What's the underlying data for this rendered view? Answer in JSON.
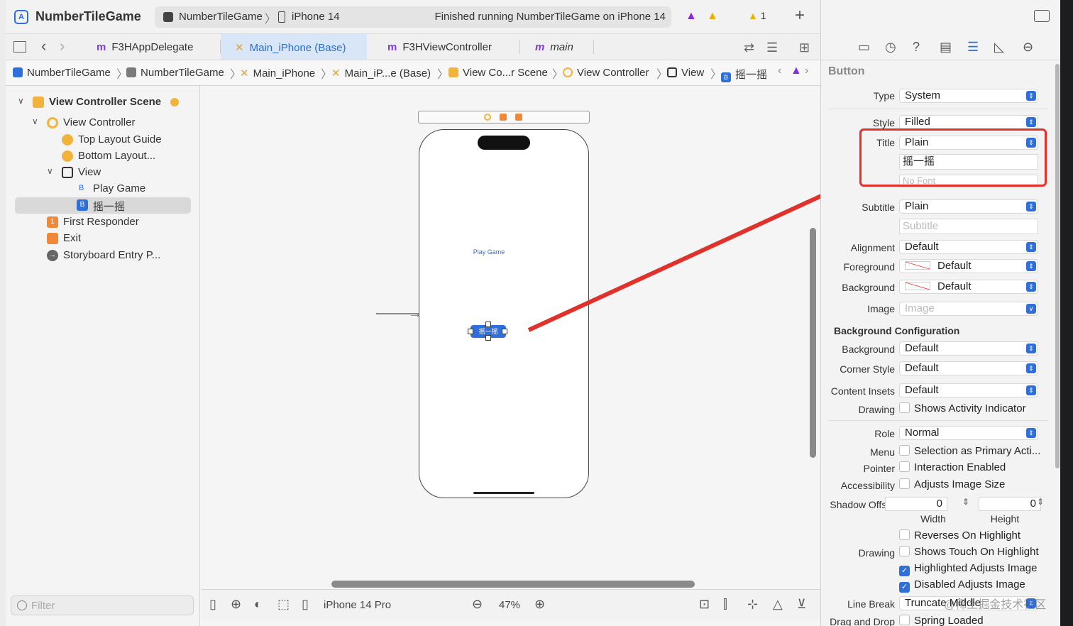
{
  "titlebar": {
    "app_title": "NumberTileGame",
    "scheme": "NumberTileGame",
    "device": "iPhone 14",
    "status": "Finished running NumberTileGame on iPhone 14",
    "issue_count": "1"
  },
  "tabs": [
    {
      "label": "F3HAppDelegate",
      "kind": "m"
    },
    {
      "label": "Main_iPhone (Base)",
      "kind": "storyboard"
    },
    {
      "label": "F3HViewController",
      "kind": "m"
    },
    {
      "label": "main",
      "kind": "m"
    }
  ],
  "breadcrumb": [
    "NumberTileGame",
    "NumberTileGame",
    "Main_iPhone",
    "Main_iP...e (Base)",
    "View Co...r Scene",
    "View Controller",
    "View",
    "摇一摇"
  ],
  "navigator": {
    "items": [
      {
        "label": "View Controller Scene"
      },
      {
        "label": "View Controller"
      },
      {
        "label": "Top Layout Guide"
      },
      {
        "label": "Bottom Layout..."
      },
      {
        "label": "View"
      },
      {
        "label": "Play Game"
      },
      {
        "label": "摇一摇"
      },
      {
        "label": "First Responder"
      },
      {
        "label": "Exit"
      },
      {
        "label": "Storyboard Entry P..."
      }
    ],
    "filter_placeholder": "Filter"
  },
  "canvas": {
    "play_game_label": "Play Game",
    "shake_button_label": "摇一摇",
    "device_label": "iPhone 14 Pro",
    "zoom": "47%"
  },
  "inspector": {
    "section": "Button",
    "type_label": "Type",
    "type_value": "System",
    "style_label": "Style",
    "style_value": "Filled",
    "title_label": "Title",
    "title_value": "Plain",
    "title_text": "摇一摇",
    "title_font_placeholder": "No Font",
    "subtitle_label": "Subtitle",
    "subtitle_value": "Plain",
    "subtitle_placeholder": "Subtitle",
    "alignment_label": "Alignment",
    "alignment_value": "Default",
    "foreground_label": "Foreground",
    "foreground_value": "Default",
    "background_label": "Background",
    "background_value": "Default",
    "image_label": "Image",
    "image_placeholder": "Image",
    "bg_config_title": "Background Configuration",
    "bgc_background_label": "Background",
    "bgc_background_value": "Default",
    "corner_label": "Corner Style",
    "corner_value": "Default",
    "insets_label": "Content Insets",
    "insets_value": "Default",
    "drawing_label": "Drawing",
    "drawing_check": "Shows Activity Indicator",
    "role_label": "Role",
    "role_value": "Normal",
    "menu_label": "Menu",
    "menu_check": "Selection as Primary Acti...",
    "pointer_label": "Pointer",
    "pointer_check": "Interaction Enabled",
    "accessibility_label": "Accessibility",
    "accessibility_check": "Adjusts Image Size",
    "shadow_label": "Shadow Offset",
    "shadow_width": "0",
    "shadow_height": "0",
    "width_label": "Width",
    "height_label": "Height",
    "reverses_check": "Reverses On Highlight",
    "drawing2_label": "Drawing",
    "shows_touch_check": "Shows Touch On Highlight",
    "highlighted_check": "Highlighted Adjusts Image",
    "disabled_check": "Disabled Adjusts Image",
    "linebreak_label": "Line Break",
    "linebreak_value": "Truncate Middle",
    "dragdrop_label": "Drag and Drop",
    "spring_check": "Spring Loaded"
  },
  "watermark": "@稀土掘金技术社区",
  "colors": {
    "accent": "#2f6fdc",
    "annotation": "#e0312a"
  }
}
